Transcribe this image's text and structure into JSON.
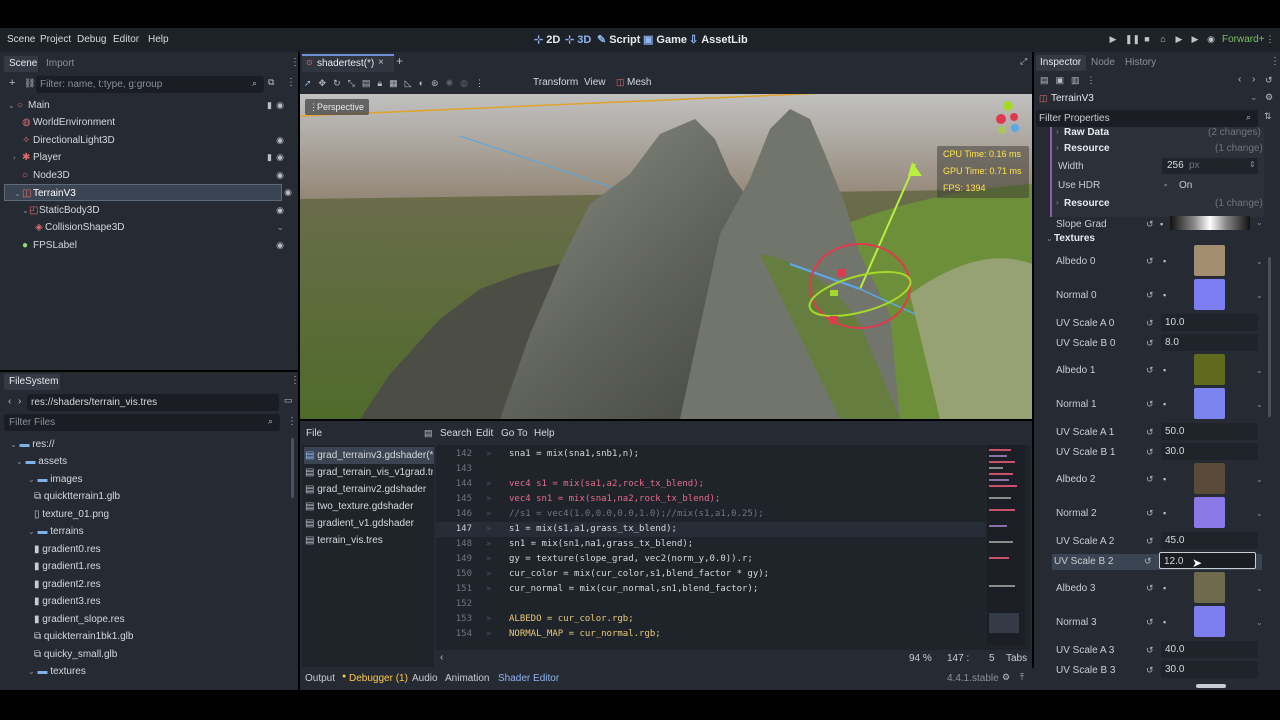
{
  "menubar": {
    "scene": "Scene",
    "project": "Project",
    "debug": "Debug",
    "editor": "Editor",
    "help": "Help",
    "modes": [
      "2D",
      "3D",
      "Script",
      "Game",
      "AssetLib"
    ],
    "renderer": "Forward+"
  },
  "scene_dock": {
    "tab_scene": "Scene",
    "tab_import": "Import",
    "filter_placeholder": "Filter: name, t:type, g:group",
    "nodes": [
      "Main",
      "WorldEnvironment",
      "DirectionalLight3D",
      "Player",
      "Node3D",
      "TerrainV3",
      "StaticBody3D",
      "CollisionShape3D",
      "FPSLabel"
    ]
  },
  "filesystem": {
    "tab": "FileSystem",
    "path": "res://shaders/terrain_vis.tres",
    "filter_placeholder": "Filter Files",
    "items": [
      "res://",
      "assets",
      "images",
      "quicktterrain1.glb",
      "texture_01.png",
      "terrains",
      "gradient0.res",
      "gradient1.res",
      "gradient2.res",
      "gradient3.res",
      "gradient_slope.res",
      "quickterrain1bk1.glb",
      "quicky_small.glb",
      "textures"
    ]
  },
  "viewport": {
    "tab": "shadertest(*)",
    "toolbar": {
      "transform": "Transform",
      "view": "View",
      "mesh": "Mesh"
    },
    "perspective": "Perspective",
    "stats": {
      "cpu": "CPU Time: 0.16 ms",
      "gpu": "GPU Time: 0.71 ms",
      "fps": "FPS: 1394"
    }
  },
  "script_editor": {
    "menu": {
      "file": "File",
      "search": "Search",
      "edit": "Edit",
      "goto": "Go To",
      "help": "Help"
    },
    "files": [
      "grad_terrainv3.gdshader(*)",
      "grad_terrain_vis_v1grad.tr...",
      "grad_terrainv2.gdshader",
      "two_texture.gdshader",
      "gradient_v1.gdshader",
      "terrain_vis.tres"
    ],
    "lines": [
      {
        "n": "142",
        "code": "sna1 = mix(sna1,snb1,n);"
      },
      {
        "n": "143",
        "code": ""
      },
      {
        "n": "144",
        "code": "vec4 s1 = mix(sa1,a2,rock_tx_blend);"
      },
      {
        "n": "145",
        "code": "vec4 sn1 = mix(sna1,na2,rock_tx_blend);"
      },
      {
        "n": "146",
        "code": "//s1 = vec4(1.0,0.0,0.0,1.0);//mix(s1,a1,0.25);"
      },
      {
        "n": "147",
        "code": "s1 = mix(s1,a1,grass_tx_blend);"
      },
      {
        "n": "148",
        "code": "sn1 = mix(sn1,na1,grass_tx_blend);"
      },
      {
        "n": "149",
        "code": "gy = texture(slope_grad, vec2(norm_y,0.0)).r;"
      },
      {
        "n": "150",
        "code": "cur_color = mix(cur_color,s1,blend_factor * gy);"
      },
      {
        "n": "151",
        "code": "cur_normal = mix(cur_normal,sn1,blend_factor);"
      },
      {
        "n": "152",
        "code": ""
      },
      {
        "n": "153",
        "code": "ALBEDO = cur_color.rgb;"
      },
      {
        "n": "154",
        "code": "NORMAL_MAP = cur_normal.rgb;"
      }
    ],
    "status": {
      "zoom": "94 %",
      "line": "147 :",
      "col": "5",
      "indent": "Tabs"
    }
  },
  "bottom_panel": {
    "output": "Output",
    "debugger": "Debugger (1)",
    "audio": "Audio",
    "animation": "Animation",
    "shader_editor": "Shader Editor",
    "version": "4.4.1.stable"
  },
  "inspector": {
    "tabs": [
      "Inspector",
      "Node",
      "History"
    ],
    "object": "TerrainV3",
    "filter_placeholder": "Filter Properties",
    "raw_data": "Raw Data",
    "raw_data_changes": "(2 changes)",
    "resource1": "Resource",
    "resource1_changes": "(1 change)",
    "width_label": "Width",
    "width_value": "256",
    "width_unit": "px",
    "hdr_label": "Use HDR",
    "hdr_value": "On",
    "resource2": "Resource",
    "resource2_changes": "(1 change)",
    "slope_grad": "Slope Grad",
    "textures_section": "Textures",
    "props": [
      {
        "label": "Albedo 0",
        "type": "tex",
        "color": "#a48e70"
      },
      {
        "label": "Normal 0",
        "type": "tex",
        "color": "#7d7df2"
      },
      {
        "label": "UV Scale A 0",
        "type": "num",
        "value": "10.0"
      },
      {
        "label": "UV Scale B 0",
        "type": "num",
        "value": "8.0"
      },
      {
        "label": "Albedo 1",
        "type": "tex",
        "color": "#5f6a1f"
      },
      {
        "label": "Normal 1",
        "type": "tex",
        "color": "#7b83f0"
      },
      {
        "label": "UV Scale A 1",
        "type": "num",
        "value": "50.0"
      },
      {
        "label": "UV Scale B 1",
        "type": "num",
        "value": "30.0"
      },
      {
        "label": "Albedo 2",
        "type": "tex",
        "color": "#5a4a38"
      },
      {
        "label": "Normal 2",
        "type": "tex",
        "color": "#8a78e6"
      },
      {
        "label": "UV Scale A 2",
        "type": "num",
        "value": "45.0"
      },
      {
        "label": "UV Scale B 2",
        "type": "num",
        "value": "12.0"
      },
      {
        "label": "Albedo 3",
        "type": "tex",
        "color": "#6f6a4e"
      },
      {
        "label": "Normal 3",
        "type": "tex",
        "color": "#7e7ef0"
      },
      {
        "label": "UV Scale A 3",
        "type": "num",
        "value": "40.0"
      },
      {
        "label": "UV Scale B 3",
        "type": "num",
        "value": "30.0"
      }
    ]
  }
}
